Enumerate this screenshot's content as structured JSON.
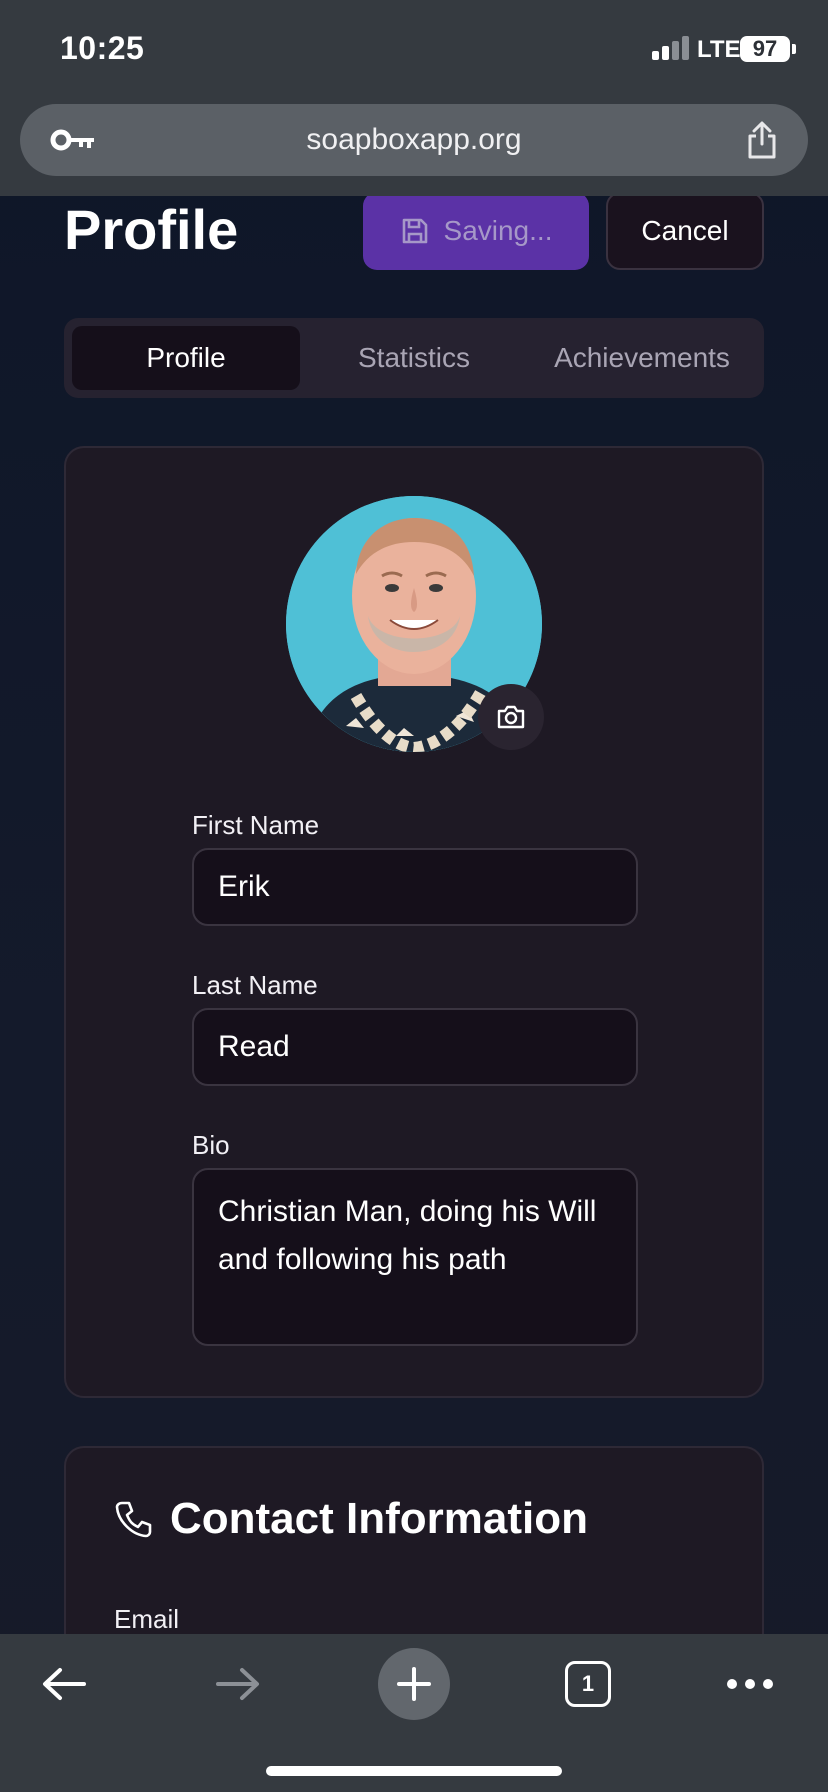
{
  "status_bar": {
    "time": "10:25",
    "network": "LTE",
    "battery": "97"
  },
  "browser": {
    "url": "soapboxapp.org",
    "tab_count": "1"
  },
  "header": {
    "title": "Profile",
    "saving_label": "Saving...",
    "cancel_label": "Cancel"
  },
  "tabs": [
    {
      "label": "Profile",
      "active": true
    },
    {
      "label": "Statistics",
      "active": false
    },
    {
      "label": "Achievements",
      "active": false
    }
  ],
  "profile_form": {
    "first_name_label": "First Name",
    "first_name_value": "Erik",
    "last_name_label": "Last Name",
    "last_name_value": "Read",
    "bio_label": "Bio",
    "bio_value": "Christian Man, doing his Will and following his path"
  },
  "contact": {
    "heading": "Contact Information",
    "email_label": "Email"
  },
  "colors": {
    "accent_purple": "#5b32a6",
    "card_bg": "#1e1924",
    "input_bg": "#150f1a",
    "chrome_bg": "#353a40"
  },
  "icons": {
    "address_bar_left": "key-icon",
    "address_bar_right": "share-icon",
    "saving_button": "floppy-disk-icon",
    "avatar_overlay": "camera-icon",
    "contact_heading": "phone-icon",
    "toolbar": [
      "back-arrow-icon",
      "forward-arrow-icon",
      "plus-icon",
      "tabs-icon",
      "more-icon"
    ]
  }
}
